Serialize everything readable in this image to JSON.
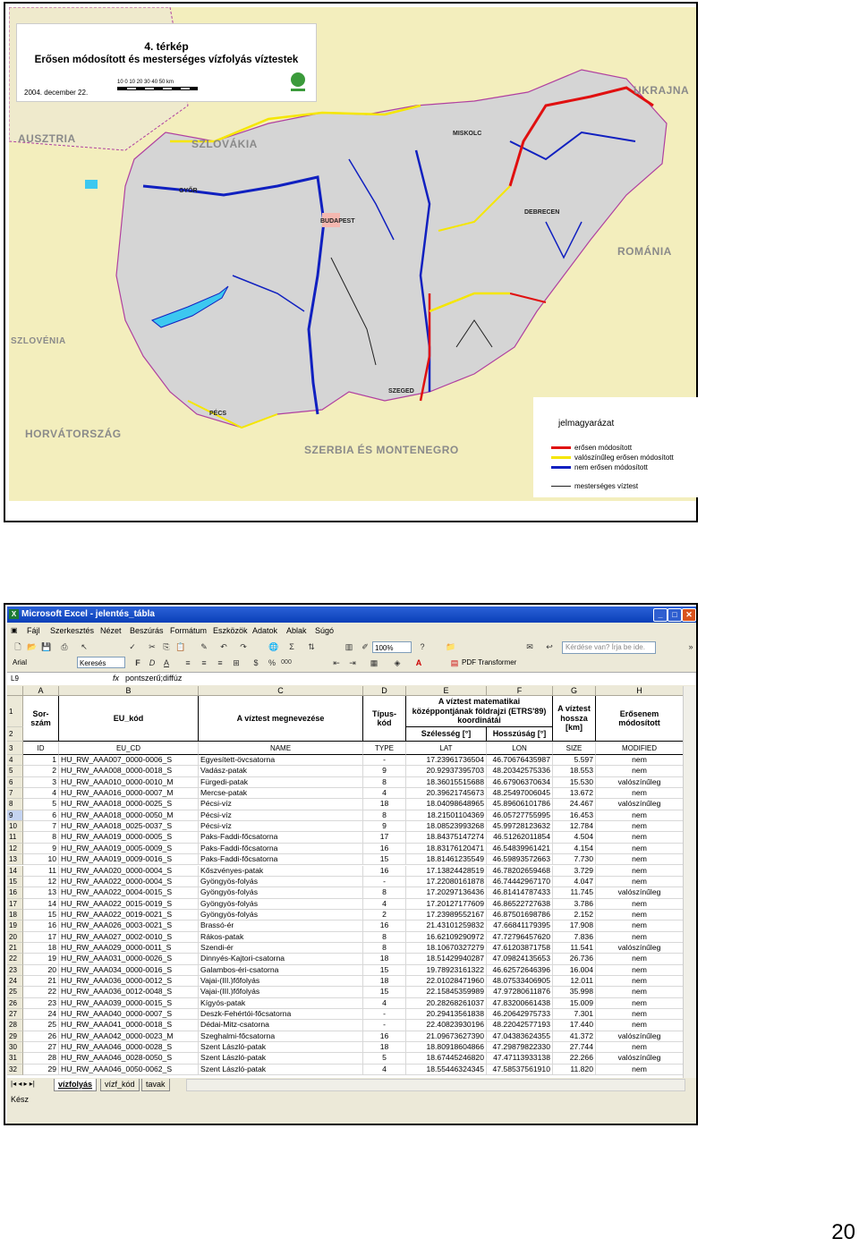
{
  "map": {
    "title_line1": "4. térkép",
    "title_line2": "Erősen módosított és mesterséges vízfolyás víztestek",
    "date": "2004. december 22.",
    "scale_ticks": "10  0  10  20  30  40  50  km",
    "countries": [
      "AUSZTRIA",
      "SZLOVÁKIA",
      "UKRAJNA",
      "ROMÁNIA",
      "SZLOVÉNIA",
      "HORVÁTORSZÁG",
      "SZERBIA ÉS MONTENEGRO"
    ],
    "cities": [
      "MISKOLC",
      "GYŐR",
      "BUDAPEST",
      "DEBRECEN",
      "SZEGED",
      "PÉCS"
    ],
    "legend": {
      "title": "jelmagyarázat",
      "items": [
        {
          "label": "erősen módosított",
          "color": "#e01010"
        },
        {
          "label": "valószínűleg erősen módosított",
          "color": "#f5e600"
        },
        {
          "label": "nem erősen módosított",
          "color": "#1020c0"
        },
        {
          "label": "mesterséges víztest",
          "color": "#202020"
        }
      ]
    },
    "colors": {
      "land": "#d8d8d8",
      "outside": "#f3eebd",
      "border": "#b040a0"
    }
  },
  "excel": {
    "title": "Microsoft Excel - jelentés_tábla",
    "menu": [
      "Fájl",
      "Szerkesztés",
      "Nézet",
      "Beszúrás",
      "Formátum",
      "Eszközök",
      "Adatok",
      "Ablak",
      "Súgó"
    ],
    "ask_placeholder": "Kérdése van? Írja be ide.",
    "zoom": "100%",
    "font": "Arial",
    "search_label": "Keresés",
    "pdf_label": "PDF Transformer",
    "namebox": "L9",
    "fx": "fx",
    "formula": "pontszerű;diffúz",
    "columns": [
      "A",
      "B",
      "C",
      "D",
      "E",
      "F",
      "G",
      "H"
    ],
    "header_row1": {
      "A": "Sor-\nszám",
      "B": "EU_kód",
      "C": "A víztest megnevezése",
      "D": "Típus-\nkód",
      "EF": "A víztest matematikai középpontjának földrajzi (ETRS'89) koordinátái",
      "G": "A víztest hossza [km]",
      "H": "Erősenem módosított"
    },
    "header_row2": {
      "E": "Szélesség [°]",
      "F": "Hosszúság [°]"
    },
    "header_row3": [
      "ID",
      "EU_CD",
      "NAME",
      "TYPE",
      "LAT",
      "LON",
      "SIZE",
      "MODIFIED"
    ],
    "rows": [
      {
        "r": "4",
        "id": "1",
        "eu": "HU_RW_AAA007_0000-0006_S",
        "name": "Egyesített-övcsatorna",
        "type": "-",
        "lat": "17.23961736504",
        "lon": "46.70676435987",
        "size": "5.597",
        "mod": "nem"
      },
      {
        "r": "5",
        "id": "2",
        "eu": "HU_RW_AAA008_0000-0018_S",
        "name": "Vadász-patak",
        "type": "9",
        "lat": "20.92937395703",
        "lon": "48.20342575336",
        "size": "18.553",
        "mod": "nem"
      },
      {
        "r": "6",
        "id": "3",
        "eu": "HU_RW_AAA010_0000-0010_M",
        "name": "Fürgedi-patak",
        "type": "8",
        "lat": "18.36015515688",
        "lon": "46.67906370634",
        "size": "15.530",
        "mod": "valószínűleg"
      },
      {
        "r": "7",
        "id": "4",
        "eu": "HU_RW_AAA016_0000-0007_M",
        "name": "Mercse-patak",
        "type": "4",
        "lat": "20.39621745673",
        "lon": "48.25497006045",
        "size": "13.672",
        "mod": "nem"
      },
      {
        "r": "8",
        "id": "5",
        "eu": "HU_RW_AAA018_0000-0025_S",
        "name": "Pécsi-víz",
        "type": "18",
        "lat": "18.04098648965",
        "lon": "45.89606101786",
        "size": "24.467",
        "mod": "valószínűleg"
      },
      {
        "r": "9",
        "id": "6",
        "eu": "HU_RW_AAA018_0000-0050_M",
        "name": "Pécsi-víz",
        "type": "8",
        "lat": "18.21501104369",
        "lon": "46.05727755995",
        "size": "16.453",
        "mod": "nem"
      },
      {
        "r": "10",
        "id": "7",
        "eu": "HU_RW_AAA018_0025-0037_S",
        "name": "Pécsi-víz",
        "type": "9",
        "lat": "18.08523993268",
        "lon": "45.99728123632",
        "size": "12.784",
        "mod": "nem"
      },
      {
        "r": "11",
        "id": "8",
        "eu": "HU_RW_AAA019_0000-0005_S",
        "name": "Paks-Faddi-főcsatorna",
        "type": "17",
        "lat": "18.84375147274",
        "lon": "46.51262011854",
        "size": "4.504",
        "mod": "nem"
      },
      {
        "r": "12",
        "id": "9",
        "eu": "HU_RW_AAA019_0005-0009_S",
        "name": "Paks-Faddi-főcsatorna",
        "type": "16",
        "lat": "18.83176120471",
        "lon": "46.54839961421",
        "size": "4.154",
        "mod": "nem"
      },
      {
        "r": "13",
        "id": "10",
        "eu": "HU_RW_AAA019_0009-0016_S",
        "name": "Paks-Faddi-főcsatorna",
        "type": "15",
        "lat": "18.81461235549",
        "lon": "46.59893572663",
        "size": "7.730",
        "mod": "nem"
      },
      {
        "r": "14",
        "id": "11",
        "eu": "HU_RW_AAA020_0000-0004_S",
        "name": "Kőszvényes-patak",
        "type": "16",
        "lat": "17.13824428519",
        "lon": "46.78202659468",
        "size": "3.729",
        "mod": "nem"
      },
      {
        "r": "15",
        "id": "12",
        "eu": "HU_RW_AAA022_0000-0004_S",
        "name": "Gyöngyös-folyás",
        "type": "-",
        "lat": "17.22080161878",
        "lon": "46.74442967170",
        "size": "4.047",
        "mod": "nem"
      },
      {
        "r": "16",
        "id": "13",
        "eu": "HU_RW_AAA022_0004-0015_S",
        "name": "Gyöngyös-folyás",
        "type": "8",
        "lat": "17.20297136436",
        "lon": "46.81414787433",
        "size": "11.745",
        "mod": "valószínűleg"
      },
      {
        "r": "17",
        "id": "14",
        "eu": "HU_RW_AAA022_0015-0019_S",
        "name": "Gyöngyös-folyás",
        "type": "4",
        "lat": "17.20127177609",
        "lon": "46.86522727638",
        "size": "3.786",
        "mod": "nem"
      },
      {
        "r": "18",
        "id": "15",
        "eu": "HU_RW_AAA022_0019-0021_S",
        "name": "Gyöngyös-folyás",
        "type": "2",
        "lat": "17.23989552167",
        "lon": "46.87501698786",
        "size": "2.152",
        "mod": "nem"
      },
      {
        "r": "19",
        "id": "16",
        "eu": "HU_RW_AAA026_0003-0021_S",
        "name": "Brassó-ér",
        "type": "16",
        "lat": "21.43101259832",
        "lon": "47.66841179395",
        "size": "17.908",
        "mod": "nem"
      },
      {
        "r": "20",
        "id": "17",
        "eu": "HU_RW_AAA027_0002-0010_S",
        "name": "Rákos-patak",
        "type": "8",
        "lat": "16.62109290972",
        "lon": "47.72796457620",
        "size": "7.836",
        "mod": "nem"
      },
      {
        "r": "21",
        "id": "18",
        "eu": "HU_RW_AAA029_0000-0011_S",
        "name": "Szendi-ér",
        "type": "8",
        "lat": "18.10670327279",
        "lon": "47.61203871758",
        "size": "11.541",
        "mod": "valószínűleg"
      },
      {
        "r": "22",
        "id": "19",
        "eu": "HU_RW_AAA031_0000-0026_S",
        "name": "Dinnyés-Kajtori-csatorna",
        "type": "18",
        "lat": "18.51429940287",
        "lon": "47.09824135653",
        "size": "26.736",
        "mod": "nem"
      },
      {
        "r": "23",
        "id": "20",
        "eu": "HU_RW_AAA034_0000-0016_S",
        "name": "Galambos-éri-csatorna",
        "type": "15",
        "lat": "19.78923161322",
        "lon": "46.62572646396",
        "size": "16.004",
        "mod": "nem"
      },
      {
        "r": "24",
        "id": "21",
        "eu": "HU_RW_AAA036_0000-0012_S",
        "name": "Vajai-(III.)főfolyás",
        "type": "18",
        "lat": "22.01028471960",
        "lon": "48.07533406905",
        "size": "12.011",
        "mod": "nem"
      },
      {
        "r": "25",
        "id": "22",
        "eu": "HU_RW_AAA036_0012-0048_S",
        "name": "Vajai-(III.)főfolyás",
        "type": "15",
        "lat": "22.15845359989",
        "lon": "47.97280611876",
        "size": "35.998",
        "mod": "nem"
      },
      {
        "r": "26",
        "id": "23",
        "eu": "HU_RW_AAA039_0000-0015_S",
        "name": "Kígyós-patak",
        "type": "4",
        "lat": "20.28268261037",
        "lon": "47.83200661438",
        "size": "15.009",
        "mod": "nem"
      },
      {
        "r": "27",
        "id": "24",
        "eu": "HU_RW_AAA040_0000-0007_S",
        "name": "Deszk-Fehértói-főcsatorna",
        "type": "-",
        "lat": "20.29413561838",
        "lon": "46.20642975733",
        "size": "7.301",
        "mod": "nem"
      },
      {
        "r": "28",
        "id": "25",
        "eu": "HU_RW_AAA041_0000-0018_S",
        "name": "Dédai-Mitz-csatorna",
        "type": "-",
        "lat": "22.40823930196",
        "lon": "48.22042577193",
        "size": "17.440",
        "mod": "nem"
      },
      {
        "r": "29",
        "id": "26",
        "eu": "HU_RW_AAA042_0000-0023_M",
        "name": "Szeghalmi-főcsatorna",
        "type": "16",
        "lat": "21.09673627390",
        "lon": "47.04383624355",
        "size": "41.372",
        "mod": "valószínűleg"
      },
      {
        "r": "30",
        "id": "27",
        "eu": "HU_RW_AAA046_0000-0028_S",
        "name": "Szent László-patak",
        "type": "18",
        "lat": "18.80918604866",
        "lon": "47.29879822330",
        "size": "27.744",
        "mod": "nem"
      },
      {
        "r": "31",
        "id": "28",
        "eu": "HU_RW_AAA046_0028-0050_S",
        "name": "Szent László-patak",
        "type": "5",
        "lat": "18.67445246820",
        "lon": "47.47113933138",
        "size": "22.266",
        "mod": "valószínűleg"
      },
      {
        "r": "32",
        "id": "29",
        "eu": "HU_RW_AAA046_0050-0062_S",
        "name": "Szent László-patak",
        "type": "4",
        "lat": "18.55446324345",
        "lon": "47.58537561910",
        "size": "11.820",
        "mod": "nem"
      }
    ],
    "sheet_tabs": [
      "vízfolyás",
      "vízf_kód",
      "tavak"
    ],
    "status": "Kész"
  },
  "page_number": "20"
}
